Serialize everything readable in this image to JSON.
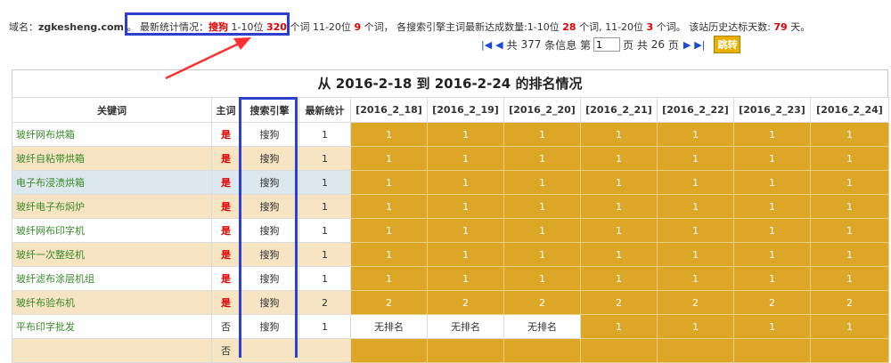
{
  "top": {
    "domain_label": "域名：",
    "domain": "zgkesheng.com",
    "sep": "。",
    "stats_label": "最新统计情况：",
    "engine": "搜狗",
    "range1": "1-10位",
    "count1": "320",
    "unit1": "个词",
    "range2": "11-20位",
    "count2": "9",
    "unit2": "个词",
    "mid": "，   各搜索引擎主词最新达成数量:1-10位",
    "reached1": "28",
    "unit3": "个词, 11-20位",
    "reached2": "3",
    "unit4": "个词。  该站历史达标天数:",
    "days": "79",
    "days_unit": "天。"
  },
  "pager": {
    "total_prefix": "共",
    "total": "377",
    "total_suffix": "条信息 第",
    "current": "1",
    "pages_prefix": "页 共",
    "pages": "26",
    "pages_suffix": "页",
    "go_label": "跳转"
  },
  "table": {
    "title": "从 2016-2-18 到 2016-2-24 的排名情况",
    "headers": [
      "关键词",
      "主词",
      "搜索引擎",
      "最新统计",
      "[2016_2_18]",
      "[2016_2_19]",
      "[2016_2_20]",
      "[2016_2_21]",
      "[2016_2_22]",
      "[2016_2_23]",
      "[2016_2_24]"
    ],
    "rows": [
      {
        "keyword": "玻纤网布烘箱",
        "main": "是",
        "engine": "搜狗",
        "latest": "1",
        "days": [
          "1",
          "1",
          "1",
          "1",
          "1",
          "1",
          "1"
        ],
        "bg": "white"
      },
      {
        "keyword": "玻纤自粘带烘箱",
        "main": "是",
        "engine": "搜狗",
        "latest": "1",
        "days": [
          "1",
          "1",
          "1",
          "1",
          "1",
          "1",
          "1"
        ],
        "bg": "tan"
      },
      {
        "keyword": "电子布浸渍烘箱",
        "main": "是",
        "engine": "搜狗",
        "latest": "1",
        "days": [
          "1",
          "1",
          "1",
          "1",
          "1",
          "1",
          "1"
        ],
        "bg": "blue"
      },
      {
        "keyword": "玻纤电子布焖炉",
        "main": "是",
        "engine": "搜狗",
        "latest": "1",
        "days": [
          "1",
          "1",
          "1",
          "1",
          "1",
          "1",
          "1"
        ],
        "bg": "tan"
      },
      {
        "keyword": "玻纤网布印字机",
        "main": "是",
        "engine": "搜狗",
        "latest": "1",
        "days": [
          "1",
          "1",
          "1",
          "1",
          "1",
          "1",
          "1"
        ],
        "bg": "white"
      },
      {
        "keyword": "玻纤一次整经机",
        "main": "是",
        "engine": "搜狗",
        "latest": "1",
        "days": [
          "1",
          "1",
          "1",
          "1",
          "1",
          "1",
          "1"
        ],
        "bg": "tan"
      },
      {
        "keyword": "玻纤滤布涂层机组",
        "main": "是",
        "engine": "搜狗",
        "latest": "1",
        "days": [
          "1",
          "1",
          "1",
          "1",
          "1",
          "1",
          "1"
        ],
        "bg": "white"
      },
      {
        "keyword": "玻纤布验布机",
        "main": "是",
        "engine": "搜狗",
        "latest": "2",
        "days": [
          "2",
          "2",
          "2",
          "2",
          "2",
          "2",
          "2"
        ],
        "bg": "tan"
      },
      {
        "keyword": "平布印字批发",
        "main": "否",
        "engine": "搜狗",
        "latest": "1",
        "days": [
          "无排名",
          "无排名",
          "无排名",
          "1",
          "1",
          "1",
          "1"
        ],
        "bg": "white"
      },
      {
        "keyword": "",
        "main": "否",
        "engine": "",
        "latest": "",
        "days": [
          "",
          "",
          "",
          "",
          "",
          "",
          ""
        ],
        "bg": "tan"
      }
    ]
  },
  "colors": {
    "highlight": "#2c3fd0",
    "arrow": "#ff3030",
    "gold_cell": "#dca626",
    "red_text": "#e00000"
  }
}
